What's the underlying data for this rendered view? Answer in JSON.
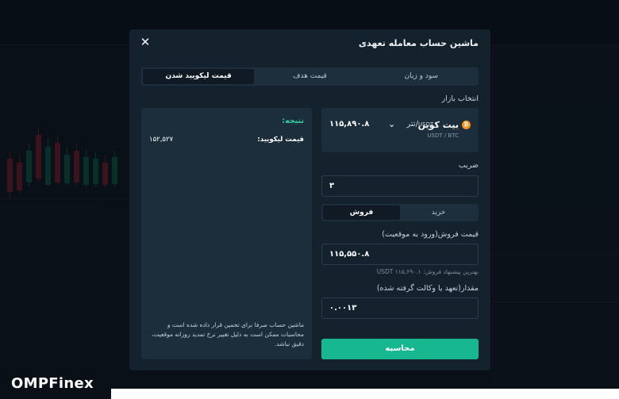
{
  "modal": {
    "title": "ماشین حساب معامله تعهدی",
    "close_icon": "close-icon",
    "tabs": [
      {
        "label": "سود و زیان",
        "active": false
      },
      {
        "label": "قیمت هدف",
        "active": false
      },
      {
        "label": "قیمت لیکویید شدن",
        "active": true
      }
    ]
  },
  "market": {
    "section_label": "انتخاب بازار",
    "coin_name": "بیت کوین",
    "coin_pair": "/تتر",
    "coin_sub": "USDT / BTC",
    "price_unit": "USDT",
    "price_value": "۱۱۵,۸۹۰.۸",
    "coin_icon": "bitcoin-icon",
    "chevron_icon": "chevron-down-icon"
  },
  "leverage": {
    "label": "ضریب",
    "value": "۳"
  },
  "side": {
    "buy_label": "خرید",
    "sell_label": "فروش",
    "active": "sell"
  },
  "entry": {
    "label": "قیمت فروش(ورود به موقعیت)",
    "value": "۱۱۵,۵۵۰.۸",
    "hint": "بهترین پیشنهاد فروش: USDT ۱۱۵,۶۹۰.۱"
  },
  "amount": {
    "label": "مقدار(تعهد یا وکالت گرفته شده)",
    "value": "۰.۰۰۱۳"
  },
  "calculate_label": "محاسبه",
  "result": {
    "title": "نتیجه:",
    "liq_label": "قیمت لیکویید:",
    "liq_value": "۱۵۲,۵۲۷",
    "disclaimer": "ماشین حساب صرفا برای تخمین قرار داده شده است و محاسبات ممکن است به دلیل تغییر نرخ تمدید روزانه موقعیت، دقیق نباشد."
  },
  "logo": "OMPFinex",
  "colors": {
    "accent": "#17b890",
    "result_title": "#2ed3a5",
    "modal_bg": "#14222e",
    "panel_bg": "#1c2e3b"
  }
}
